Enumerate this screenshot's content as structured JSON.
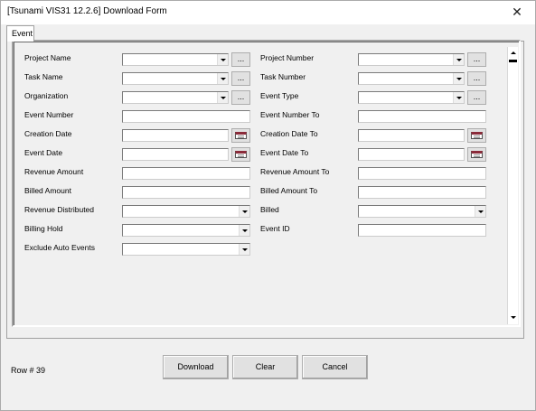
{
  "window": {
    "title": "[Tsunami VIS31 12.2.6] Download Form",
    "close_label": "✕"
  },
  "tabs": [
    {
      "label": "Event"
    }
  ],
  "fields": {
    "project_name": {
      "label": "Project Name",
      "value": "",
      "ellipsis": "..."
    },
    "project_number": {
      "label": "Project Number",
      "value": "",
      "ellipsis": "..."
    },
    "task_name": {
      "label": "Task Name",
      "value": "",
      "ellipsis": "..."
    },
    "task_number": {
      "label": "Task Number",
      "value": "",
      "ellipsis": "..."
    },
    "organization": {
      "label": "Organization",
      "value": "",
      "ellipsis": "..."
    },
    "event_type": {
      "label": "Event Type",
      "value": "",
      "ellipsis": "..."
    },
    "event_number": {
      "label": "Event Number",
      "value": ""
    },
    "event_number_to": {
      "label": "Event Number To",
      "value": ""
    },
    "creation_date": {
      "label": "Creation Date",
      "value": ""
    },
    "creation_date_to": {
      "label": "Creation Date To",
      "value": ""
    },
    "event_date": {
      "label": "Event Date",
      "value": ""
    },
    "event_date_to": {
      "label": "Event Date To",
      "value": ""
    },
    "revenue_amount": {
      "label": "Revenue Amount",
      "value": ""
    },
    "revenue_amount_to": {
      "label": "Revenue Amount To",
      "value": ""
    },
    "billed_amount": {
      "label": "Billed Amount",
      "value": ""
    },
    "billed_amount_to": {
      "label": "Billed Amount To",
      "value": ""
    },
    "revenue_distributed": {
      "label": "Revenue Distributed",
      "value": ""
    },
    "billed": {
      "label": "Billed",
      "value": ""
    },
    "billing_hold": {
      "label": "Billing Hold",
      "value": ""
    },
    "event_id": {
      "label": "Event ID",
      "value": ""
    },
    "exclude_auto_events": {
      "label": "Exclude Auto Events",
      "value": ""
    }
  },
  "footer": {
    "row_label": "Row # 39",
    "download_label": "Download",
    "clear_label": "Clear",
    "cancel_label": "Cancel"
  }
}
